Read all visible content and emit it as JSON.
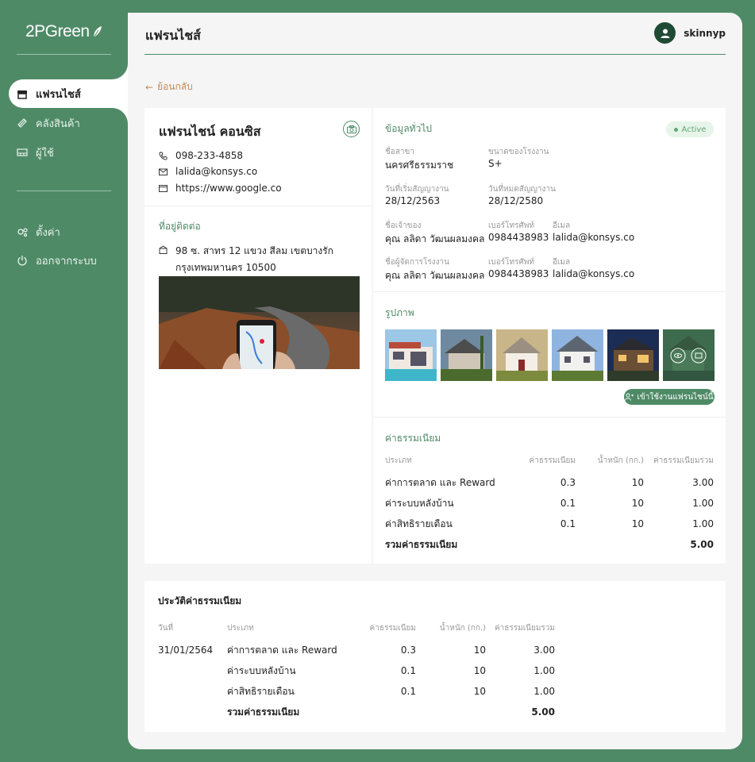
{
  "brand": {
    "logo_text": "2PGreen"
  },
  "sidebar": {
    "items": [
      {
        "label": "แฟรนไชส์",
        "icon": "store-icon",
        "active": true
      },
      {
        "label": "คลังสินค้า",
        "icon": "package-icon"
      },
      {
        "label": "ผู้ใช้",
        "icon": "users-icon"
      }
    ],
    "bottom_items": [
      {
        "label": "ตั้งค่า",
        "icon": "settings-icon"
      },
      {
        "label": "ออกจากระบบ",
        "icon": "power-icon"
      }
    ]
  },
  "header": {
    "title": "แฟรนไชส์",
    "username": "skinnyp"
  },
  "back_label": "ย้อนกลับ",
  "franchise": {
    "name": "แฟรนไชน์ คอนซิส",
    "phone": "098-233-4858",
    "email": "lalida@konsys.co",
    "website": "https://www.google.co",
    "address_title": "ที่อยู่ติดต่อ",
    "address_line1": "98 ซ. สาทร 12 แขวง สีลม เขตบางรัก",
    "address_line2": "กรุงเทพมหานคร 10500"
  },
  "general": {
    "title": "ข้อมูลทั่วไป",
    "status": "Active",
    "branch_label": "ชื่อสาขา",
    "branch": "นครศรีธรรมราช",
    "size_label": "ขนาดของโรงงาน",
    "size": "S+",
    "start_label": "วันที่เริ่มสัญญางาน",
    "start": "28/12/2563",
    "end_label": "วันที่หมดสัญญางาน",
    "end": "28/12/2580",
    "owner_label": "ชื่อเจ้าของ",
    "owner": "คุณ ลลิดา วัฒนผลมงคล",
    "owner_phone_label": "เบอร์โทรศัพท์",
    "owner_phone": "0984438983",
    "owner_email_label": "อีเมล",
    "owner_email": "lalida@konsys.co",
    "manager_label": "ชื่อผู้จัดการโรงงาน",
    "manager": "คุณ ลลิดา วัฒนผลมงคล",
    "manager_phone_label": "เบอร์โทรศัพท์",
    "manager_phone": "0984438983",
    "manager_email_label": "อีเมล",
    "manager_email": "lalida@konsys.co"
  },
  "photos": {
    "title": "รูปภาพ",
    "use_button": "เข้าใช้งานแฟรนไชน์นี้"
  },
  "fees": {
    "title": "ค่าธรรมเนียม",
    "headers": [
      "ประเภท",
      "ค่าธรรมเนียม",
      "น้ำหนัก (กก.)",
      "ค่าธรรมเนียมรวม"
    ],
    "rows": [
      [
        "ค่าการตลาด และ Reward",
        "0.3",
        "10",
        "3.00"
      ],
      [
        "ค่าระบบหลังบ้าน",
        "0.1",
        "10",
        "1.00"
      ],
      [
        "ค่าสิทธิรายเดือน",
        "0.1",
        "10",
        "1.00"
      ]
    ],
    "total_label": "รวมค่าธรรมเนียม",
    "total": "5.00"
  },
  "history": {
    "title": "ประวัติค่าธรรมเนียม",
    "headers": [
      "วันที่",
      "ประเภท",
      "ค่าธรรมเนียม",
      "น้ำหนัก (กก.)",
      "ค่าธรรมเนียมรวม"
    ],
    "date": "31/01/2564",
    "rows": [
      [
        "ค่าการตลาด และ Reward",
        "0.3",
        "10",
        "3.00"
      ],
      [
        "ค่าระบบหลังบ้าน",
        "0.1",
        "10",
        "1.00"
      ],
      [
        "ค่าสิทธิรายเดือน",
        "0.1",
        "10",
        "1.00"
      ]
    ],
    "total_label": "รวมค่าธรรมเนียม",
    "total": "5.00"
  },
  "colors": {
    "brand": "#4f8a67",
    "accent": "#c48a55",
    "status": "#5fa872"
  }
}
